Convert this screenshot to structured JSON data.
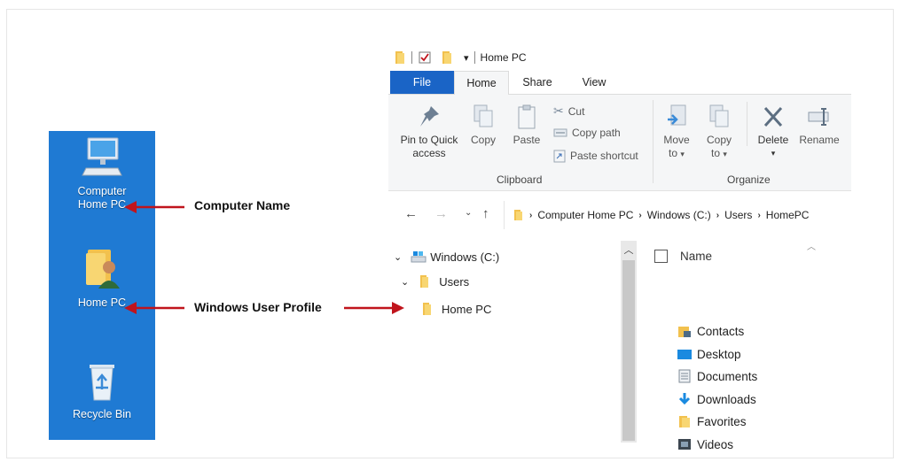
{
  "desktop": {
    "computer_label_1": "Computer",
    "computer_label_2": "Home PC",
    "user_label": "Home PC",
    "recycle_label": "Recycle Bin"
  },
  "annotations": {
    "computer_name": "Computer Name",
    "user_profile": "Windows User Profile"
  },
  "explorer": {
    "title": "Home PC",
    "tabs": [
      "File",
      "Home",
      "Share",
      "View"
    ],
    "ribbon": {
      "pin_line1": "Pin to Quick",
      "pin_line2": "access",
      "copy": "Copy",
      "paste": "Paste",
      "cut": "Cut",
      "copy_path": "Copy path",
      "paste_shortcut": "Paste shortcut",
      "clipboard_group": "Clipboard",
      "move_to_line1": "Move",
      "move_to_line2": "to",
      "copy_to_line1": "Copy",
      "copy_to_line2": "to",
      "delete": "Delete",
      "rename": "Rename",
      "organize_group": "Organize"
    },
    "breadcrumb": [
      "Computer Home PC",
      "Windows (C:)",
      "Users",
      "HomePC"
    ],
    "tree": {
      "drive": "Windows (C:)",
      "users": "Users",
      "home": "Home PC"
    },
    "column_name": "Name",
    "files": [
      "Contacts",
      "Desktop",
      "Documents",
      "Downloads",
      "Favorites",
      "Videos"
    ]
  },
  "colors": {
    "desktop_bg": "#1f7ad3",
    "file_tab": "#1a64c6",
    "arrow": "#c0141c",
    "folder": "#f2c14e"
  }
}
